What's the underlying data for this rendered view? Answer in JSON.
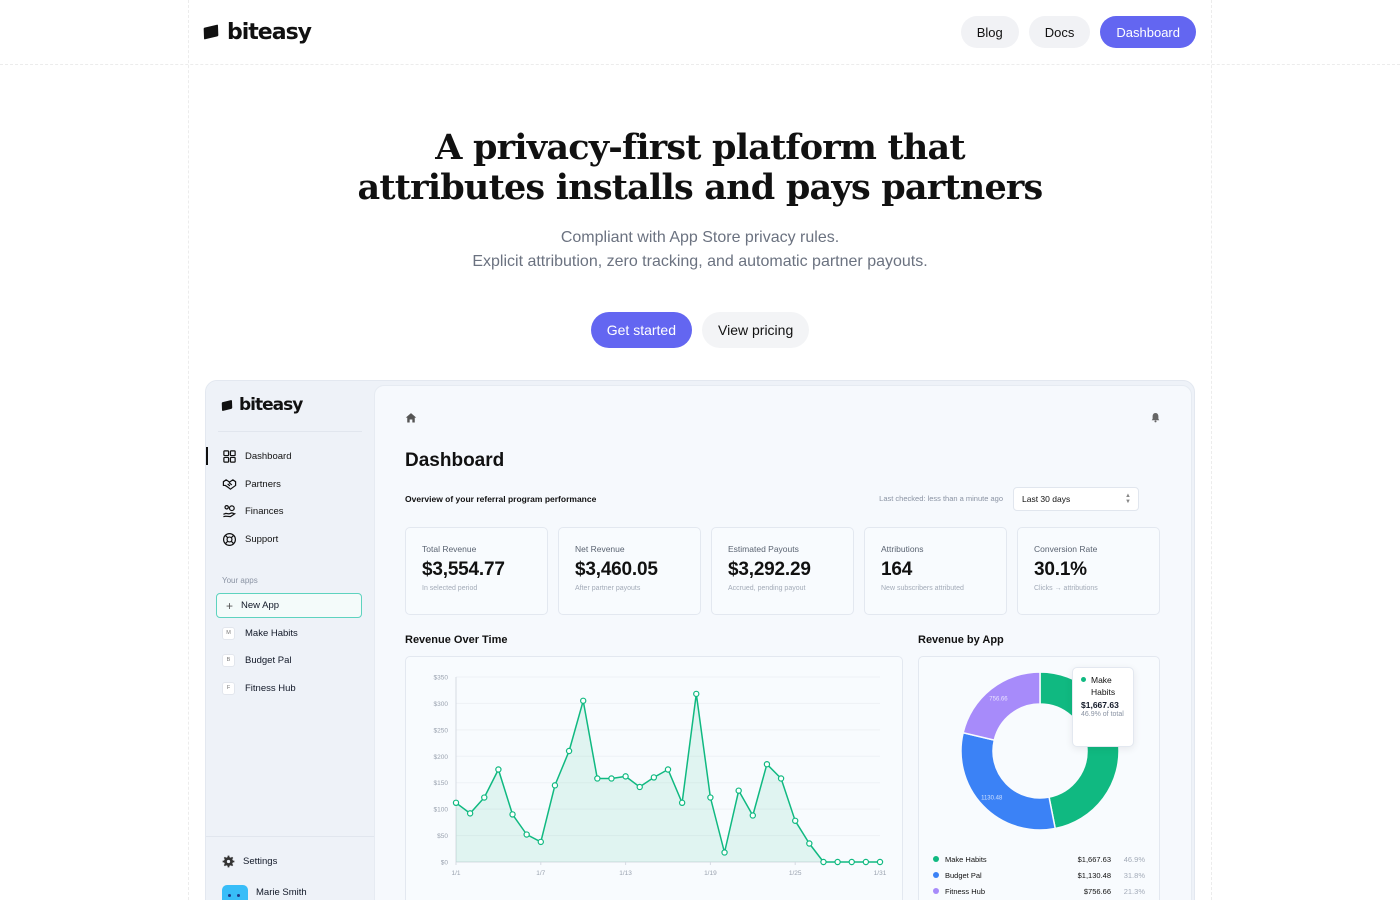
{
  "nav": {
    "brand": "biteasy",
    "links": [
      "Blog",
      "Docs"
    ],
    "dashboard": "Dashboard"
  },
  "hero": {
    "title_line1": "A privacy-first platform that",
    "title_line2": "attributes installs and pays partners",
    "sub_line1": "Compliant with App Store privacy rules.",
    "sub_line2": "Explicit attribution, zero tracking, and automatic partner payouts.",
    "cta_primary": "Get started",
    "cta_secondary": "View pricing"
  },
  "app": {
    "brand": "biteasy",
    "sidebar": {
      "items": [
        {
          "label": "Dashboard",
          "icon": "grid-icon"
        },
        {
          "label": "Partners",
          "icon": "handshake-icon"
        },
        {
          "label": "Finances",
          "icon": "hand-coins-icon"
        },
        {
          "label": "Support",
          "icon": "lifebuoy-icon"
        }
      ],
      "apps_label": "Your apps",
      "new_app": "New App",
      "apps": [
        {
          "badge": "M",
          "name": "Make Habits"
        },
        {
          "badge": "B",
          "name": "Budget Pal"
        },
        {
          "badge": "F",
          "name": "Fitness Hub"
        }
      ],
      "settings": "Settings",
      "user": "Marie Smith"
    },
    "main": {
      "title": "Dashboard",
      "overview": "Overview of your referral program performance",
      "last_checked": "Last checked: less than a minute ago",
      "range": "Last 30 days",
      "stats": [
        {
          "label": "Total Revenue",
          "value": "$3,554.77",
          "hint": "In selected period"
        },
        {
          "label": "Net Revenue",
          "value": "$3,460.05",
          "hint": "After partner payouts"
        },
        {
          "label": "Estimated Payouts",
          "value": "$3,292.29",
          "hint": "Accrued, pending payout"
        },
        {
          "label": "Attributions",
          "value": "164",
          "hint": "New subscribers attributed"
        },
        {
          "label": "Conversion Rate",
          "value": "30.1%",
          "hint": "Clicks → attributions"
        }
      ],
      "revenue_title": "Revenue Over Time",
      "by_app_title": "Revenue by App"
    },
    "tooltip": {
      "name": "Make Habits",
      "value": "$1,667.63",
      "pct": "46.9% of total"
    }
  },
  "colors": {
    "accent": "#6366f1",
    "line": "#10b981",
    "blue": "#3b82f6",
    "purple": "#a78bfa"
  },
  "chart_data": [
    {
      "type": "area",
      "title": "Revenue Over Time",
      "x_ticks": [
        "1/1",
        "1/7",
        "1/13",
        "1/19",
        "1/25",
        "1/31"
      ],
      "y_ticks": [
        "$0",
        "$50",
        "$100",
        "$150",
        "$200",
        "$250",
        "$300",
        "$350"
      ],
      "ylim": [
        0,
        350
      ],
      "series": [
        {
          "values": [
            112,
            92,
            122,
            175,
            90,
            52,
            38,
            145,
            210,
            305,
            158,
            158,
            162,
            142,
            160,
            175,
            112,
            318,
            122,
            18,
            135,
            88,
            185,
            158,
            78,
            35,
            0,
            0,
            0,
            0,
            0
          ]
        }
      ]
    },
    {
      "type": "pie",
      "title": "Revenue by App",
      "categories": [
        "Make Habits",
        "Budget Pal",
        "Fitness Hub"
      ],
      "values": [
        1667.63,
        1130.48,
        756.66
      ],
      "value_labels": [
        "$1,667.63",
        "$1,130.48",
        "$756.66"
      ],
      "percent_labels": [
        "46.9%",
        "31.8%",
        "21.3%"
      ],
      "slice_labels": [
        "1667.63",
        "1130.48",
        "756.66"
      ],
      "colors": [
        "#10b981",
        "#3b82f6",
        "#a78bfa"
      ],
      "donut": true
    }
  ]
}
